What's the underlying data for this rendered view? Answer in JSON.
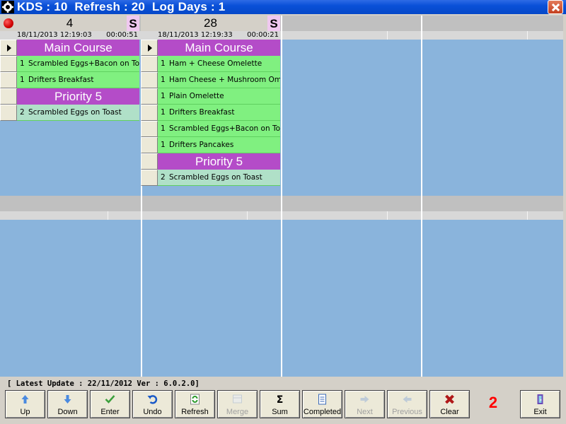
{
  "window": {
    "title": "KDS : 10  Refresh : 20  Log Days : 1"
  },
  "orders": [
    {
      "number": "4",
      "has_alert": true,
      "badge": "S",
      "timestamp": "18/11/2013 12:19:03",
      "elapsed": "00:00:51",
      "rows": [
        {
          "type": "course",
          "label": "Main Course"
        },
        {
          "type": "item",
          "qty": "1",
          "name": "Scrambled Eggs+Bacon on Toast"
        },
        {
          "type": "item",
          "qty": "1",
          "name": "Drifters Breakfast"
        },
        {
          "type": "course",
          "label": "Priority 5"
        },
        {
          "type": "item",
          "qty": "2",
          "name": "Scrambled Eggs on Toast",
          "done": true
        }
      ]
    },
    {
      "number": "28",
      "has_alert": false,
      "badge": "S",
      "timestamp": "18/11/2013 12:19:33",
      "elapsed": "00:00:21",
      "rows": [
        {
          "type": "course",
          "label": "Main Course"
        },
        {
          "type": "item",
          "qty": "1",
          "name": "Ham + Cheese Omelette"
        },
        {
          "type": "item",
          "qty": "1",
          "name": "Ham Cheese + Mushroom Omelet"
        },
        {
          "type": "item",
          "qty": "1",
          "name": "Plain Omelette"
        },
        {
          "type": "item",
          "qty": "1",
          "name": "Drifters Breakfast"
        },
        {
          "type": "item",
          "qty": "1",
          "name": "Scrambled Eggs+Bacon on Toast"
        },
        {
          "type": "item",
          "qty": "1",
          "name": "Drifters Pancakes"
        },
        {
          "type": "course",
          "label": "Priority 5"
        },
        {
          "type": "item",
          "qty": "2",
          "name": "Scrambled Eggs on Toast",
          "done": true
        }
      ]
    }
  ],
  "status": {
    "text": "[ Latest Update : 22/11/2012  Ver : 6.0.2.0]"
  },
  "toolbar": {
    "buttons": [
      {
        "id": "up",
        "label": "Up",
        "icon": "arrow-up-icon",
        "enabled": true
      },
      {
        "id": "down",
        "label": "Down",
        "icon": "arrow-down-icon",
        "enabled": true
      },
      {
        "id": "enter",
        "label": "Enter",
        "icon": "checkmark-icon",
        "enabled": true
      },
      {
        "id": "undo",
        "label": "Undo",
        "icon": "undo-icon",
        "enabled": true
      },
      {
        "id": "refresh",
        "label": "Refresh",
        "icon": "refresh-icon",
        "enabled": true
      },
      {
        "id": "merge",
        "label": "Merge",
        "icon": "merge-icon",
        "enabled": false
      },
      {
        "id": "sum",
        "label": "Sum",
        "icon": "sigma-icon",
        "enabled": true
      },
      {
        "id": "completed",
        "label": "Completed",
        "icon": "completed-list-icon",
        "enabled": true
      },
      {
        "id": "next",
        "label": "Next",
        "icon": "arrow-right-icon",
        "enabled": false
      },
      {
        "id": "previous",
        "label": "Previous",
        "icon": "arrow-left-icon",
        "enabled": false
      },
      {
        "id": "clear",
        "label": "Clear",
        "icon": "red-x-icon",
        "enabled": true
      },
      {
        "id": "exit",
        "label": "Exit",
        "icon": "exit-door-icon",
        "enabled": true
      }
    ],
    "counter": "2"
  },
  "colors": {
    "board_background": "#8ab4dc",
    "course_header": "#b44cc8",
    "item_pending": "#80f080",
    "item_done": "#b0e0c8",
    "badge": "#f0c8f0",
    "counter": "#ff0000",
    "titlebar": "#0548c8"
  }
}
